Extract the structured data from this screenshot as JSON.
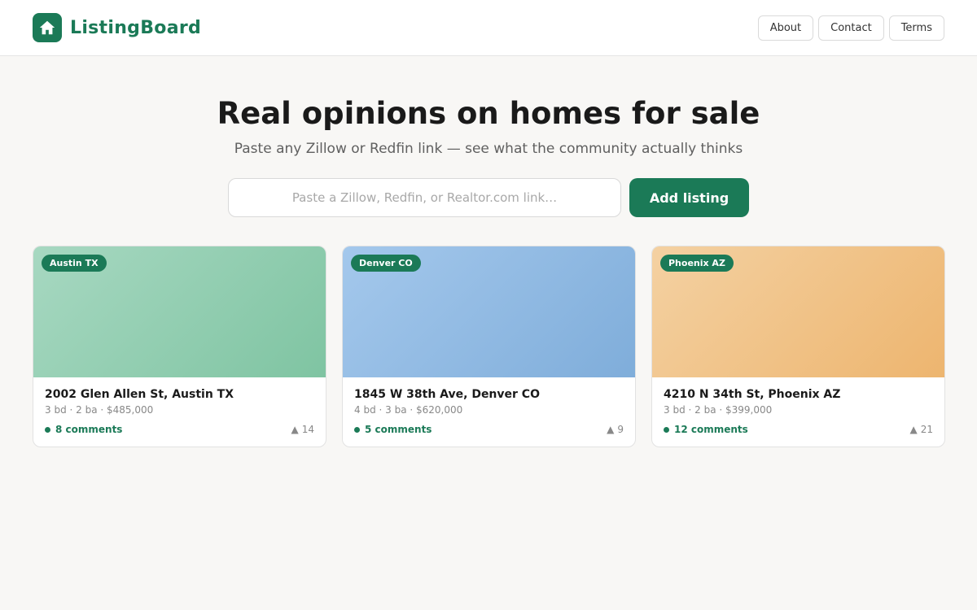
{
  "brand": {
    "name": "ListingBoard",
    "icon": "house-icon"
  },
  "nav": [
    "About",
    "Contact",
    "Terms"
  ],
  "hero": {
    "title": "Real opinions on homes for sale",
    "subtitle": "Paste any Zillow or Redfin link — see what the community actually thinks"
  },
  "add": {
    "placeholder": "Paste a Zillow, Redfin, or Realtor.com link…",
    "button": "Add listing"
  },
  "colors": {
    "accent": "#1b7a57"
  },
  "listings": [
    {
      "city": "Austin TX",
      "address": "2002 Glen Allen St, Austin TX",
      "details": "3 bd · 2 ba · $485,000",
      "comments": "8 comments",
      "votes": "14",
      "theme": "green"
    },
    {
      "city": "Denver CO",
      "address": "1845 W 38th Ave, Denver CO",
      "details": "4 bd · 3 ba · $620,000",
      "comments": "5 comments",
      "votes": "9",
      "theme": "blue"
    },
    {
      "city": "Phoenix AZ",
      "address": "4210 N 34th St, Phoenix AZ",
      "details": "3 bd · 2 ba · $399,000",
      "comments": "12 comments",
      "votes": "21",
      "theme": "orange"
    }
  ]
}
